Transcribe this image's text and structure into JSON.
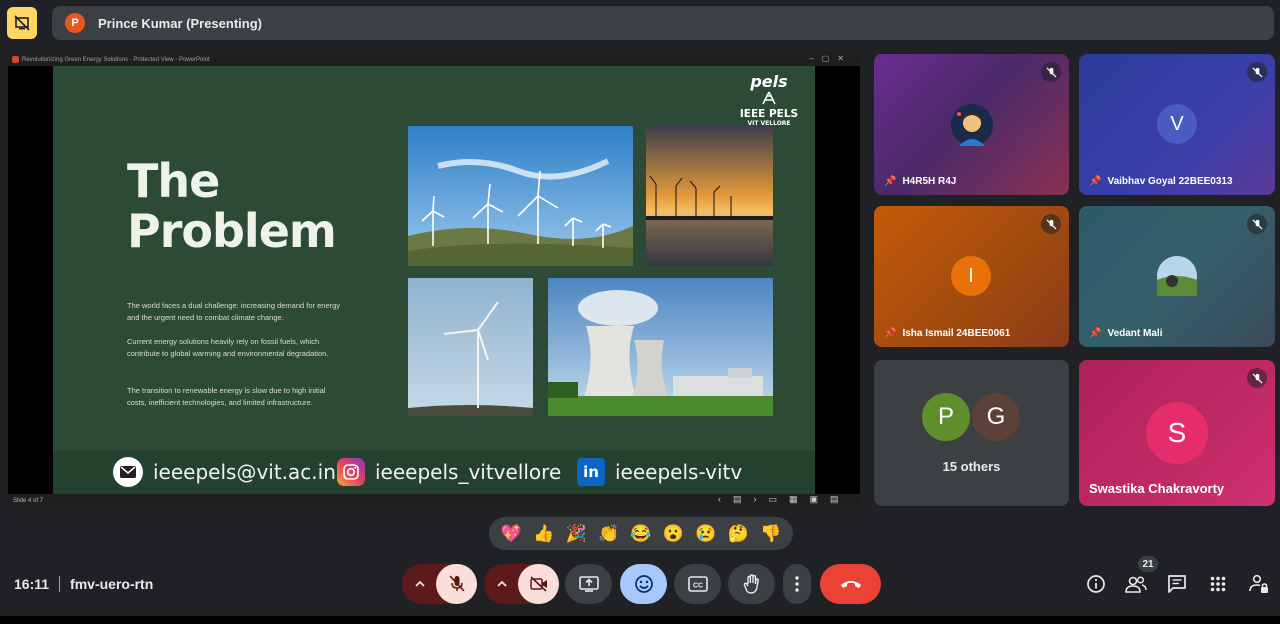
{
  "header": {
    "presenter_initial": "P",
    "presenter_label": "Prince Kumar (Presenting)"
  },
  "presentation": {
    "window_title": "Revolutionizing Green Energy Solutions  -  Protected View  -  PowerPoint",
    "slide_title_line1": "The",
    "slide_title_line2": "Problem",
    "paragraphs": [
      "The world faces a dual challenge: increasing demand for energy and the urgent need to combat climate change.",
      "Current energy solutions heavily rely on fossil fuels, which contribute to global warming and environmental degradation.",
      "The transition to renewable energy is slow due to high initial costs, inefficient technologies, and limited infrastructure."
    ],
    "logo_top": "pels",
    "logo_main": "IEEE PELS",
    "logo_sub": "VIT  VELLORE",
    "contacts": {
      "email": "ieeepels@vit.ac.in",
      "instagram": "ieeepels_vitvellore",
      "linkedin": "ieeepels-vitv",
      "linkedin_glyph": "in"
    },
    "status": "Slide 4 of 7"
  },
  "participants": [
    {
      "name": "H4R5H R4J",
      "initial": "",
      "color": "#6a3a8a"
    },
    {
      "name": "Vaibhav Goyal 22BEE0313",
      "initial": "V",
      "color": "#2f3fa0"
    },
    {
      "name": "Isha Ismail 24BEE0061",
      "initial": "I",
      "color": "#e8710a"
    },
    {
      "name": "Vedant Mali",
      "initial": "",
      "color": "#2f5f70"
    },
    {
      "name": "Swastika Chakravorty",
      "initial": "S",
      "color": "#e52d6b"
    }
  ],
  "others": {
    "initial_1": "P",
    "initial_2": "G",
    "label": "15 others"
  },
  "reactions": [
    "💖",
    "👍",
    "🎉",
    "👏",
    "😂",
    "😮",
    "😢",
    "🤔",
    "👎"
  ],
  "footer": {
    "time": "16:11",
    "meeting_code": "fmv-uero-rtn",
    "people_count": "21"
  },
  "colors": {
    "danger": "#ea4335",
    "active": "#a8c7fa",
    "muted_bg": "#f9dedc"
  }
}
